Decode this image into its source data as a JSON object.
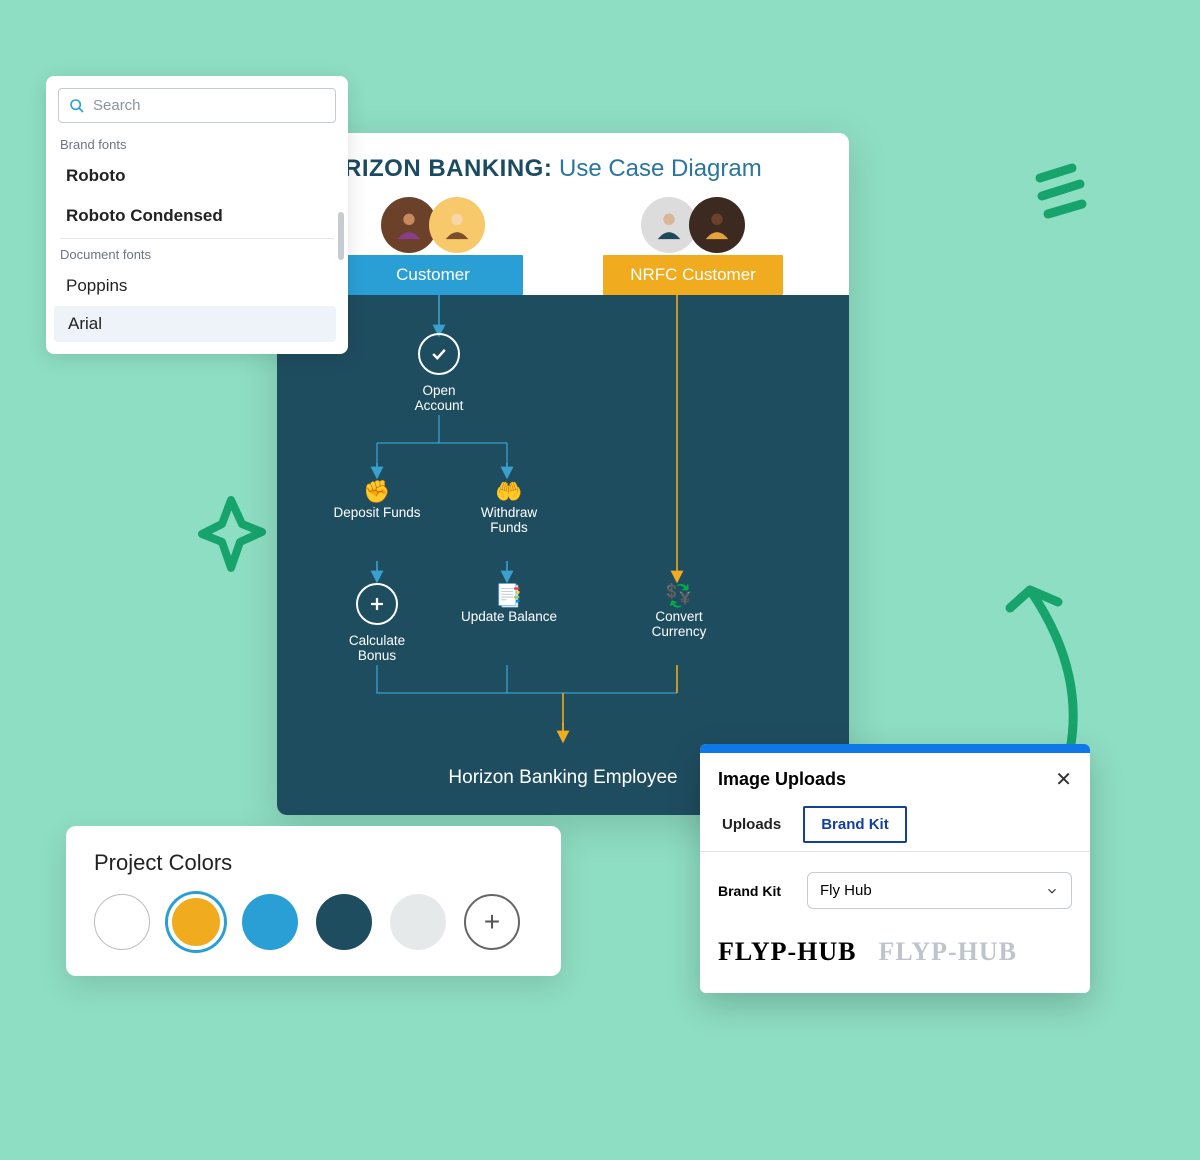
{
  "fontPanel": {
    "searchPlaceholder": "Search",
    "brandLabel": "Brand fonts",
    "docLabel": "Document fonts",
    "brandFonts": [
      "Roboto",
      "Roboto Condensed"
    ],
    "docFonts": [
      "Poppins",
      "Arial"
    ]
  },
  "diagram": {
    "brand": "HORIZON BANKING:",
    "subtitle": " Use Case Diagram",
    "customerLabel": "Customer",
    "nrfcLabel": "NRFC Customer",
    "nodes": {
      "openAccount": "Open Account",
      "depositFunds": "Deposit Funds",
      "withdrawFunds": "Withdraw Funds",
      "calcBonus": "Calculate Bonus",
      "updateBalance": "Update Balance",
      "convertCurrency": "Convert Currency"
    },
    "employee": "Horizon Banking Employee"
  },
  "colors": {
    "title": "Project Colors",
    "swatches": [
      "#ffffff",
      "#f0ab1e",
      "#2a9fd6",
      "#1f4d60",
      "#e6e9ea"
    ]
  },
  "uploads": {
    "title": "Image Uploads",
    "tabUploads": "Uploads",
    "tabBrand": "Brand Kit",
    "brandkitLabel": "Brand Kit",
    "brandkitValue": "Fly Hub",
    "logo1": "FLYP-HUB",
    "logo2": "FLYP-HUB"
  }
}
